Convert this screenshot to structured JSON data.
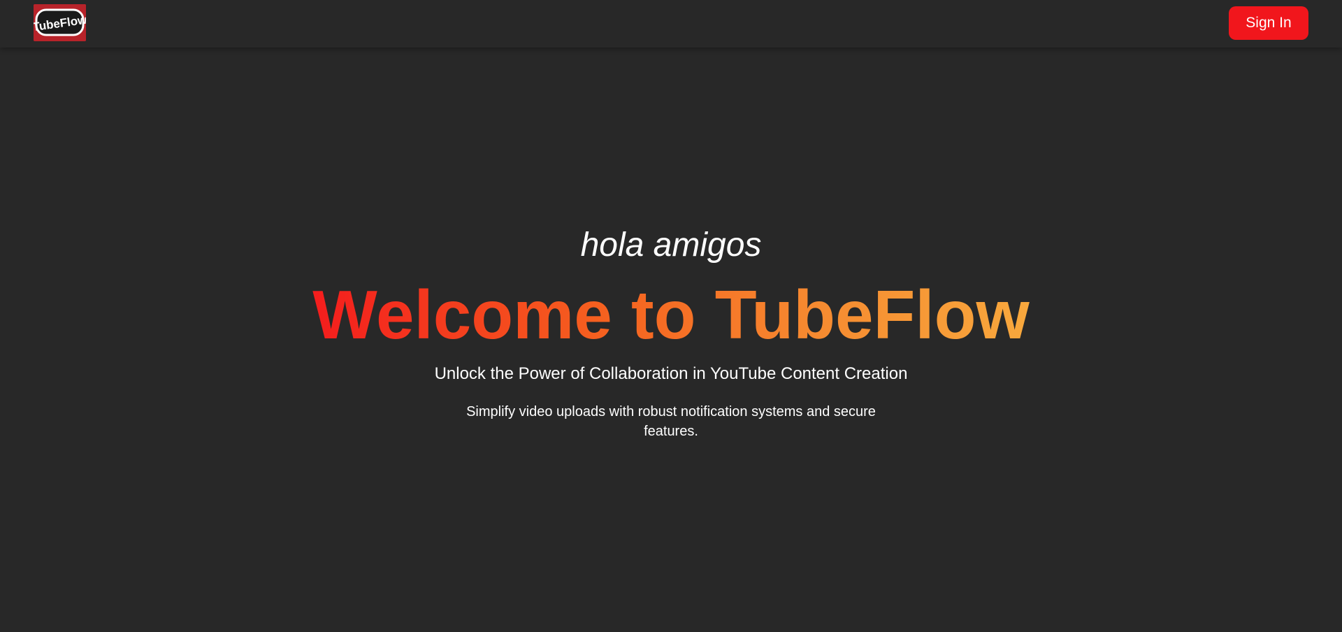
{
  "navbar": {
    "logo_text": "TubeFlow",
    "signin_label": "Sign In"
  },
  "hero": {
    "greeting": "hola amigos",
    "title": "Welcome to TubeFlow",
    "tagline": "Unlock the Power of Collaboration in YouTube Content Creation",
    "description": "Simplify video uploads with robust notification systems and secure features."
  },
  "colors": {
    "background": "#282828",
    "accent": "#f1161c",
    "gradient_start": "#f41d1d",
    "gradient_end": "#f8a83d",
    "text": "#ffffff"
  }
}
